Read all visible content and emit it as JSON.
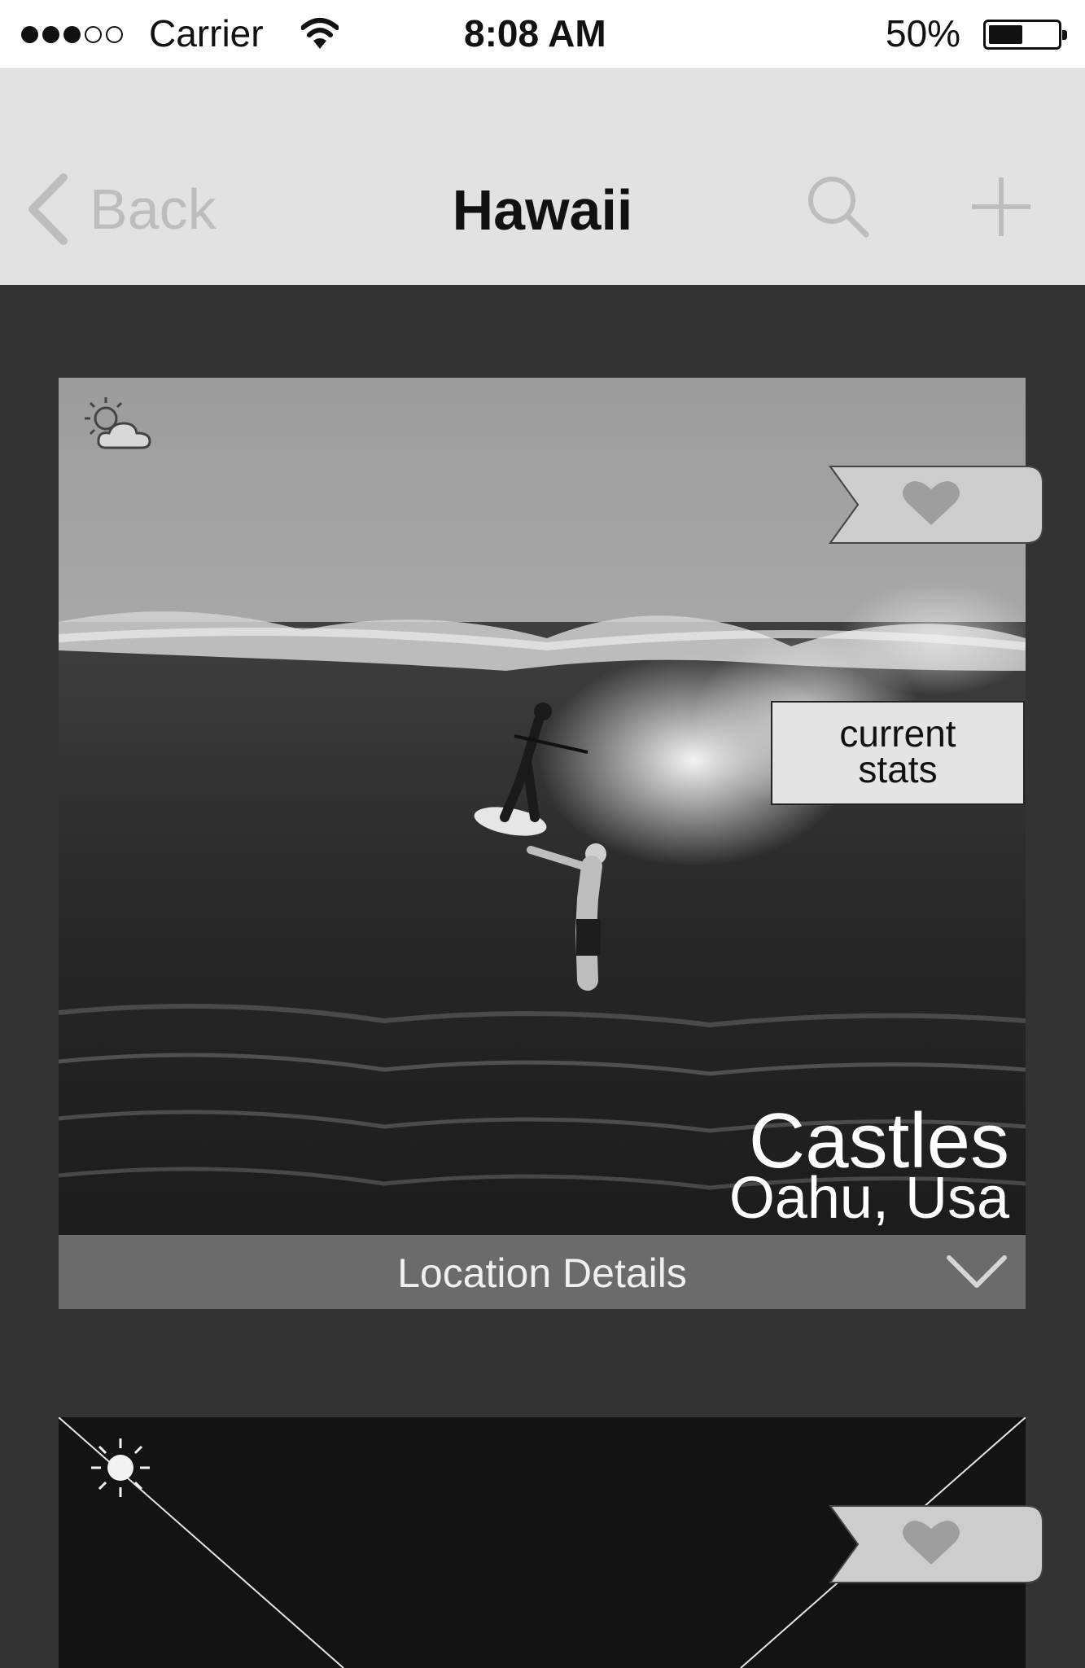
{
  "status_bar": {
    "carrier": "Carrier",
    "time": "8:08 AM",
    "battery_text": "50%",
    "battery_level": 0.5,
    "signal_bars_filled": 3,
    "signal_bars_total": 5
  },
  "nav": {
    "back_label": "Back",
    "title": "Hawaii",
    "icons": [
      "chevron-left-icon",
      "search-icon",
      "plus-icon"
    ]
  },
  "cards": [
    {
      "weather_icon": "partly-cloudy-icon",
      "favorite_icon": "heart-icon",
      "stats_label_line1": "current",
      "stats_label_line2": "stats",
      "name": "Castles",
      "location": "Oahu, Usa",
      "details_label": "Location Details",
      "details_icon": "chevron-down-icon"
    },
    {
      "weather_icon": "sun-icon",
      "favorite_icon": "heart-icon"
    }
  ],
  "colors": {
    "background": "#333333",
    "navbar": "#e2e2e2",
    "details_bar": "#6b6b6b",
    "card_placeholder": "#131313"
  }
}
